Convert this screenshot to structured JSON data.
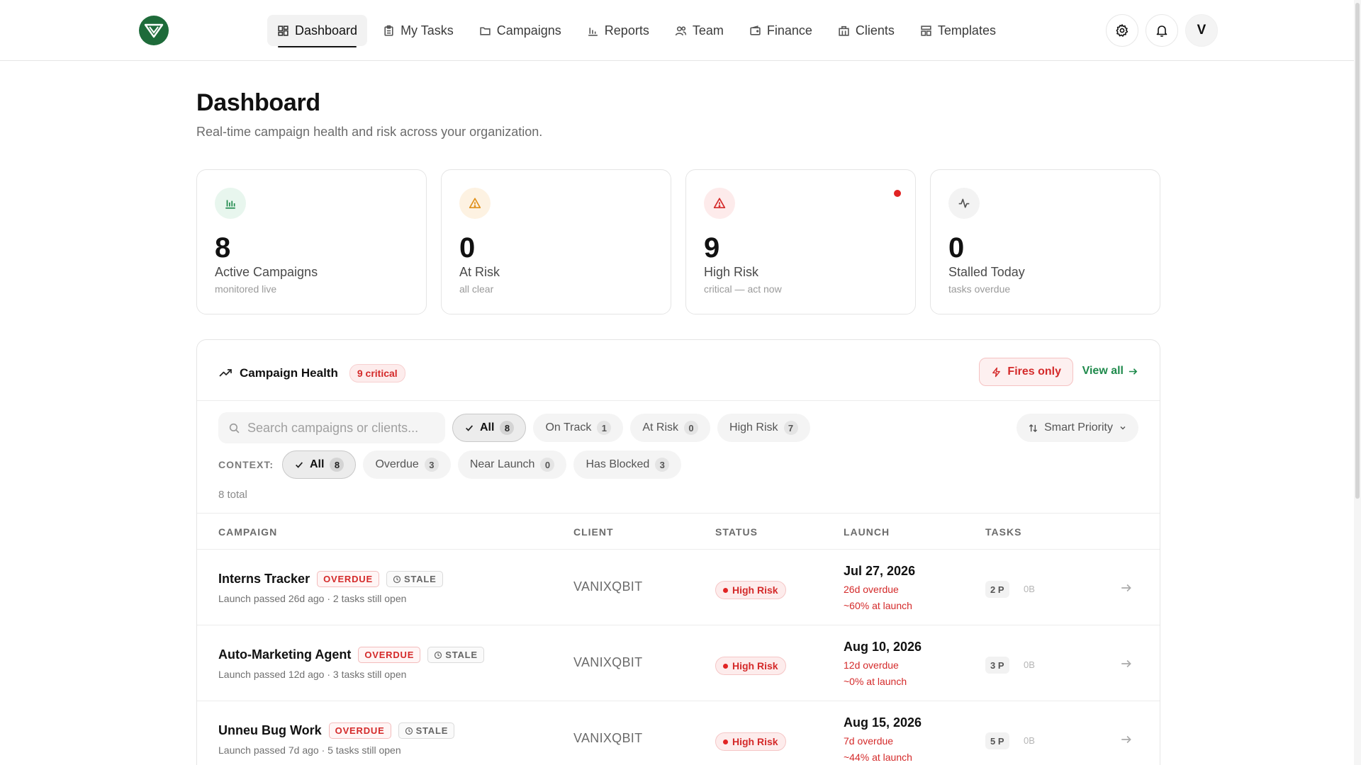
{
  "nav": {
    "items": [
      {
        "label": "Dashboard",
        "icon": "dashboard-icon",
        "active": true
      },
      {
        "label": "My Tasks",
        "icon": "clipboard-icon",
        "active": false
      },
      {
        "label": "Campaigns",
        "icon": "folder-icon",
        "active": false
      },
      {
        "label": "Reports",
        "icon": "bar-chart-icon",
        "active": false
      },
      {
        "label": "Team",
        "icon": "users-icon",
        "active": false
      },
      {
        "label": "Finance",
        "icon": "wallet-icon",
        "active": false
      },
      {
        "label": "Clients",
        "icon": "building-icon",
        "active": false
      },
      {
        "label": "Templates",
        "icon": "template-icon",
        "active": false
      }
    ],
    "avatar_initial": "V"
  },
  "header": {
    "title": "Dashboard",
    "subtitle": "Real-time campaign health and risk across your organization."
  },
  "stats": [
    {
      "value": "8",
      "label": "Active Campaigns",
      "sub": "monitored live",
      "icon": "bar-chart-icon",
      "color": "#1f8a4c"
    },
    {
      "value": "0",
      "label": "At Risk",
      "sub": "all clear",
      "icon": "warning-icon",
      "color": "#e0901a"
    },
    {
      "value": "9",
      "label": "High Risk",
      "sub": "critical — act now",
      "icon": "warning-icon",
      "color": "#d42a2a"
    },
    {
      "value": "0",
      "label": "Stalled Today",
      "sub": "tasks overdue",
      "icon": "activity-icon",
      "color": "#666666"
    }
  ],
  "panel": {
    "title": "Campaign Health",
    "critical_badge": "9 critical",
    "fires_button": "Fires only",
    "view_all": "View all",
    "search_placeholder": "Search campaigns or clients...",
    "status_filters": [
      {
        "label": "All",
        "count": "8",
        "active": true
      },
      {
        "label": "On Track",
        "count": "1",
        "active": false
      },
      {
        "label": "At Risk",
        "count": "0",
        "active": false
      },
      {
        "label": "High Risk",
        "count": "7",
        "active": false
      }
    ],
    "sort_label": "Smart Priority",
    "context_label": "CONTEXT:",
    "context_filters": [
      {
        "label": "All",
        "count": "8",
        "active": true
      },
      {
        "label": "Overdue",
        "count": "3",
        "active": false
      },
      {
        "label": "Near Launch",
        "count": "0",
        "active": false
      },
      {
        "label": "Has Blocked",
        "count": "3",
        "active": false
      }
    ],
    "total": "8 total",
    "columns": {
      "campaign": "CAMPAIGN",
      "client": "CLIENT",
      "status": "STATUS",
      "launch": "LAUNCH",
      "tasks": "TASKS"
    },
    "rows": [
      {
        "name": "Interns Tracker",
        "overdue": "OVERDUE",
        "stale": "STALE",
        "sub": "Launch passed 26d ago · 2 tasks still open",
        "client": "VANIXQBIT",
        "status": "High Risk",
        "launch_date": "Jul 27, 2026",
        "launch_overdue": "26d overdue",
        "launch_pct": "~60% at launch",
        "tasks_p": "2 P",
        "tasks_b": "0B"
      },
      {
        "name": "Auto-Marketing Agent",
        "overdue": "OVERDUE",
        "stale": "STALE",
        "sub": "Launch passed 12d ago · 3 tasks still open",
        "client": "VANIXQBIT",
        "status": "High Risk",
        "launch_date": "Aug 10, 2026",
        "launch_overdue": "12d overdue",
        "launch_pct": "~0% at launch",
        "tasks_p": "3 P",
        "tasks_b": "0B"
      },
      {
        "name": "Unneu Bug Work",
        "overdue": "OVERDUE",
        "stale": "STALE",
        "sub": "Launch passed 7d ago · 5 tasks still open",
        "client": "VANIXQBIT",
        "status": "High Risk",
        "launch_date": "Aug 15, 2026",
        "launch_overdue": "7d overdue",
        "launch_pct": "~44% at launch",
        "tasks_p": "5 P",
        "tasks_b": "0B"
      }
    ]
  }
}
